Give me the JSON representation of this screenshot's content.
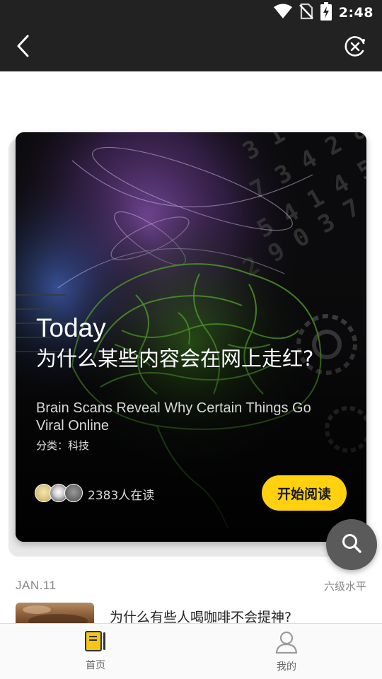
{
  "status_bar": {
    "time": "2:48",
    "icons": [
      "wifi-icon",
      "no-sim-icon",
      "battery-charging-icon"
    ]
  },
  "app_bar": {
    "back_icon": "chevron-left-icon",
    "close_icon": "close-circle-icon"
  },
  "featured": {
    "label": "Today",
    "title": "为什么某些内容会在网上走红?",
    "subtitle": "Brain Scans Reveal Why Certain Things Go Viral Online",
    "category": "分类：科技",
    "reader_count": "2383人在读",
    "start_button": "开始阅读"
  },
  "fab": {
    "icon": "search-icon"
  },
  "list": {
    "date": "JAN.11",
    "level": "六级水平",
    "items": [
      {
        "title": "为什么有些人喝咖啡不会提神?"
      }
    ]
  },
  "bottom_nav": {
    "items": [
      {
        "label": "首页",
        "icon": "book-icon",
        "active": true
      },
      {
        "label": "我的",
        "icon": "person-icon",
        "active": false
      }
    ]
  },
  "colors": {
    "header_bg": "#222222",
    "accent": "#ffd10f",
    "fab_bg": "#5a5a5a",
    "brain_green": "#4f9a2a"
  }
}
